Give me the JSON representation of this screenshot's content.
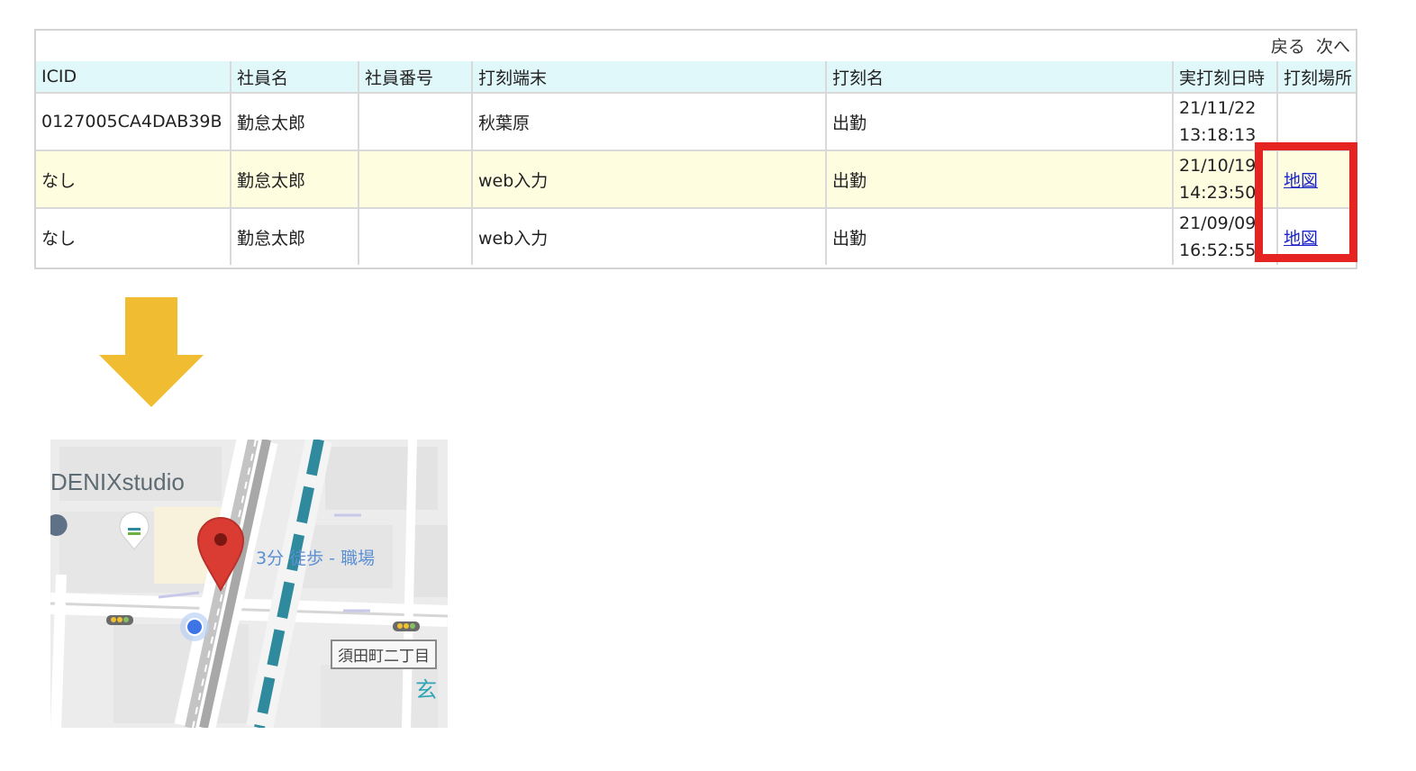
{
  "pager": {
    "back": "戻る",
    "next": "次へ"
  },
  "table": {
    "headers": [
      "ICID",
      "社員名",
      "社員番号",
      "打刻端末",
      "打刻名",
      "実打刻日時",
      "打刻場所"
    ],
    "rows": [
      {
        "icid": "0127005CA4DAB39B",
        "name": "勤怠太郎",
        "number": "",
        "terminal": "秋葉原",
        "kind": "出勤",
        "date": "21/11/22",
        "time": "13:18:13",
        "place": ""
      },
      {
        "icid": "なし",
        "name": "勤怠太郎",
        "number": "",
        "terminal": "web入力",
        "kind": "出勤",
        "date": "21/10/19",
        "time": "14:23:50",
        "place": "地図"
      },
      {
        "icid": "なし",
        "name": "勤怠太郎",
        "number": "",
        "terminal": "web入力",
        "kind": "出勤",
        "date": "21/09/09",
        "time": "16:52:55",
        "place": "地図"
      }
    ]
  },
  "map": {
    "title": "DENIXstudio",
    "walk_label": "3分 徒歩 - 職場",
    "street_label": "須田町二丁目",
    "station_label": "玄"
  },
  "colors": {
    "header_bg": "#e0f8fa",
    "highlight_row_bg": "#fffde0",
    "callout_red": "#e52421",
    "arrow_yellow": "#f0bc32",
    "link_blue": "#1a25c9"
  },
  "icons": {
    "arrow": "arrow-down-icon",
    "pin": "map-pin-icon",
    "location": "current-location-icon"
  }
}
